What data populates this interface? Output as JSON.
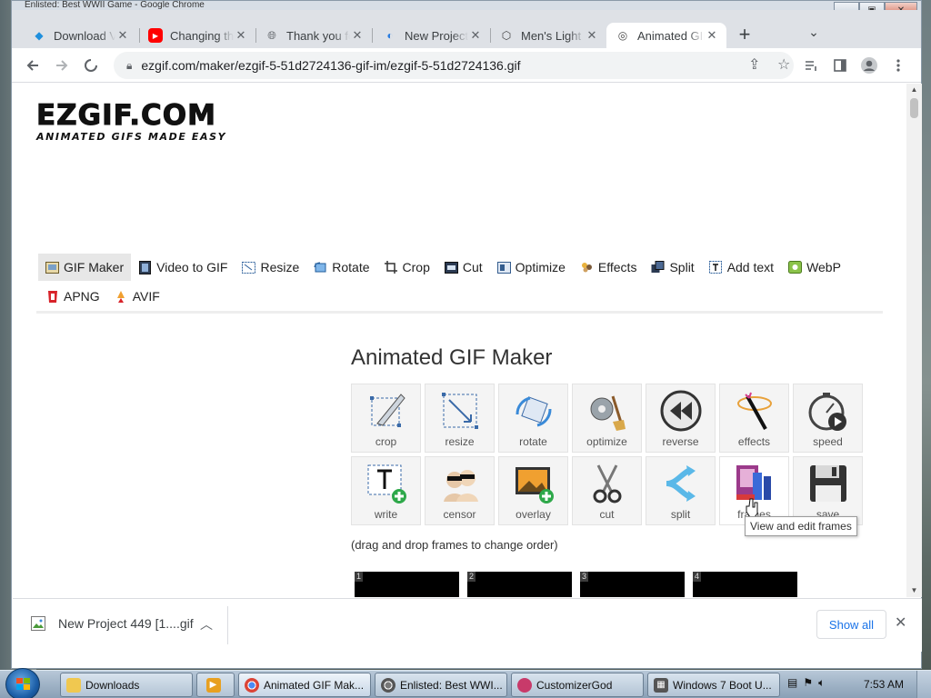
{
  "browser": {
    "title_bar_text": "Enlisted: Best WWII Game - Google Chrome",
    "tabs": [
      {
        "label": "Download Video",
        "icon": "download-app-icon"
      },
      {
        "label": "Changing the",
        "icon": "youtube-icon"
      },
      {
        "label": "Thank you for",
        "icon": "globe-icon"
      },
      {
        "label": "New Project",
        "icon": "edge-icon"
      },
      {
        "label": "Men's Light",
        "icon": "shield-icon"
      },
      {
        "label": "Animated GIF",
        "icon": "ezgif-icon",
        "active": true
      }
    ],
    "new_tab_symbol": "+",
    "tab_list_symbol": "⌄",
    "url": "ezgif.com/maker/ezgif-5-51d2724136-gif-im/ezgif-5-51d2724136.gif"
  },
  "page": {
    "logo_main": "EZGIF.COM",
    "logo_sub": "ANIMATED GIFS MADE EASY",
    "nav_row1": [
      {
        "label": "GIF Maker",
        "icon": "gif-maker-icon",
        "active": true
      },
      {
        "label": "Video to GIF",
        "icon": "film-icon"
      },
      {
        "label": "Resize",
        "icon": "resize-icon"
      },
      {
        "label": "Rotate",
        "icon": "rotate-icon"
      },
      {
        "label": "Crop",
        "icon": "crop-icon"
      },
      {
        "label": "Cut",
        "icon": "cut-icon"
      },
      {
        "label": "Optimize",
        "icon": "optimize-icon"
      },
      {
        "label": "Effects",
        "icon": "effects-icon"
      },
      {
        "label": "Split",
        "icon": "split-icon"
      },
      {
        "label": "Add text",
        "icon": "text-icon"
      },
      {
        "label": "WebP",
        "icon": "webp-icon"
      }
    ],
    "nav_row2": [
      {
        "label": "APNG",
        "icon": "apng-icon"
      },
      {
        "label": "AVIF",
        "icon": "avif-icon"
      }
    ],
    "heading": "Animated GIF Maker",
    "tools_row1": [
      "crop",
      "resize",
      "rotate",
      "optimize",
      "reverse",
      "effects",
      "speed"
    ],
    "tools_row2": [
      "write",
      "censor",
      "overlay",
      "cut",
      "split",
      "frames",
      "save"
    ],
    "tooltip": "View and edit frames",
    "hint": "(drag and drop frames to change order)",
    "frames": [
      "1",
      "2",
      "3",
      "4"
    ]
  },
  "downloads": {
    "file": "New Project 449 [1....gif",
    "show_all": "Show all",
    "close": "✕"
  },
  "taskbar": {
    "tasks": [
      {
        "label": "Downloads",
        "icon": "folder-icon"
      },
      {
        "label": "",
        "icon": "media-player-icon"
      },
      {
        "label": "Animated GIF Mak...",
        "icon": "chrome-icon",
        "active": true
      },
      {
        "label": "Enlisted: Best WWI...",
        "icon": "chrome-icon"
      },
      {
        "label": "CustomizerGod",
        "icon": "customizer-icon"
      },
      {
        "label": "Windows 7 Boot U...",
        "icon": "windows-icon"
      }
    ],
    "clock": "7:53 AM"
  },
  "colors": {
    "accent_blue": "#1a73e8",
    "tab_strip": "#dee1e6",
    "youtube_red": "#ff0000"
  }
}
